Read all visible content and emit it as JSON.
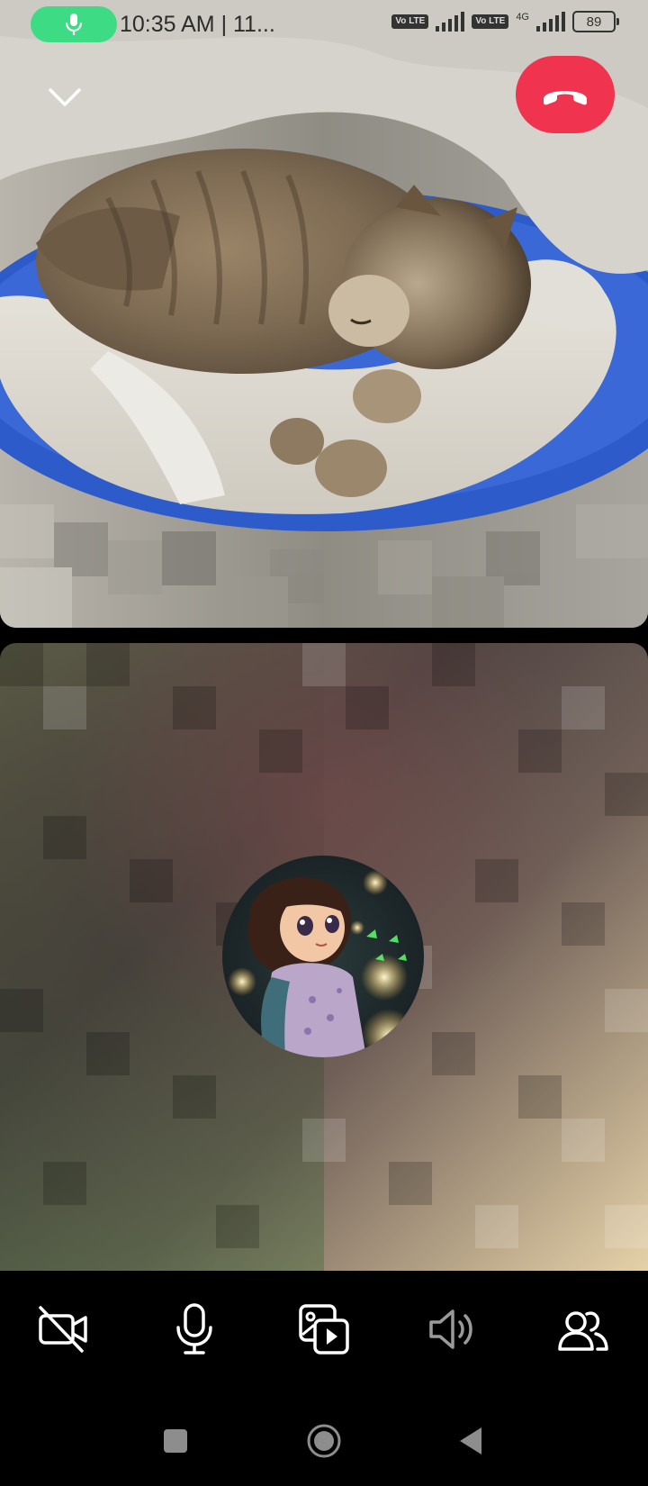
{
  "status_bar": {
    "time": "10:35 AM | 11...",
    "volte_1": "Vo LTE",
    "volte_2": "Vo LTE",
    "network": "4G",
    "battery": "89"
  },
  "icons": {
    "mic_indicator": "mic-icon",
    "collapse": "chevron-down-icon",
    "end_call": "phone-hangup-icon",
    "camera_off": "video-off-icon",
    "microphone": "mic-icon",
    "media_share": "media-share-icon",
    "speaker": "speaker-icon",
    "participants": "participants-icon"
  },
  "colors": {
    "end_call": "#f0334e",
    "mic_pill": "#3ddc84"
  }
}
